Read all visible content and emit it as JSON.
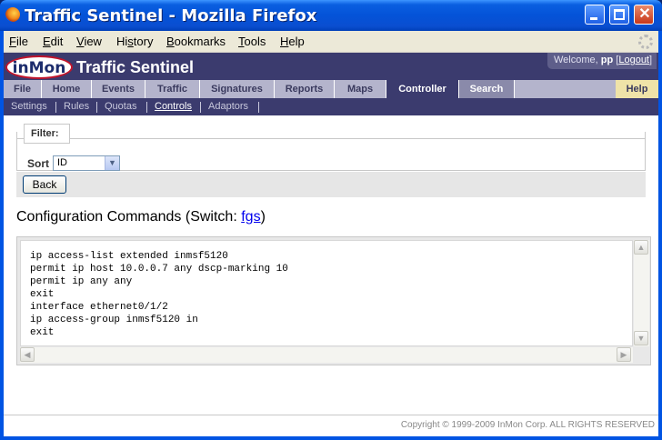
{
  "window": {
    "title": "Traffic Sentinel - Mozilla Firefox"
  },
  "menu": [
    "File",
    "Edit",
    "View",
    "History",
    "Bookmarks",
    "Tools",
    "Help"
  ],
  "menu_accel": [
    "F",
    "E",
    "V",
    "s",
    "B",
    "T",
    "H"
  ],
  "banner": {
    "logo": "inMon",
    "brand": "Traffic Sentinel",
    "welcome_prefix": "Welcome, ",
    "user": "pp",
    "logout": "Logout"
  },
  "tabs": {
    "file": "File",
    "home": "Home",
    "events": "Events",
    "traffic": "Traffic",
    "signatures": "Signatures",
    "reports": "Reports",
    "maps": "Maps",
    "controller": "Controller",
    "search": "Search",
    "help": "Help"
  },
  "subnav": {
    "settings": "Settings",
    "rules": "Rules",
    "quotas": "Quotas",
    "controls": "Controls",
    "adaptors": "Adaptors"
  },
  "filter": {
    "legend": "Filter:",
    "sort_label": "Sort",
    "sort_value": "ID"
  },
  "buttons": {
    "back": "Back"
  },
  "heading": {
    "prefix": "Configuration Commands (Switch: ",
    "switch": "fgs",
    "suffix": ")"
  },
  "commands": "ip access-list extended inmsf5120\npermit ip host 10.0.0.7 any dscp-marking 10\npermit ip any any\nexit\ninterface ethernet0/1/2\nip access-group inmsf5120 in\nexit",
  "footer": "Copyright © 1999-2009 InMon Corp. ALL RIGHTS RESERVED"
}
